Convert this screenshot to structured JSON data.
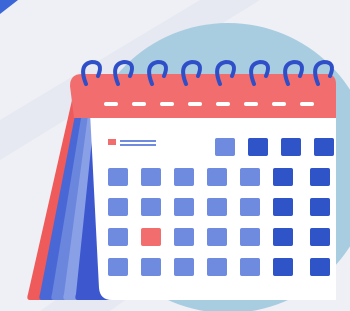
{
  "illustration": {
    "subject": "calendar-icon",
    "colors": {
      "background": "#eef0f5",
      "background_stripe": "#e4e7ef",
      "circle": "#a9cde0",
      "header_red": "#f26d6d",
      "back_page_red": "#ef5b5b",
      "back_page_blue_1": "#4a67d6",
      "back_page_blue_2": "#6a86dd",
      "back_page_blue_3": "#8aa0e6",
      "page_white": "#ffffff",
      "ring_blue": "#2f4fc9",
      "cell_light_blue": "#6f8be0",
      "cell_dark_blue": "#2f54c8",
      "cell_highlight_red": "#f26d6d",
      "corner_blue": "#3b66d8"
    }
  }
}
